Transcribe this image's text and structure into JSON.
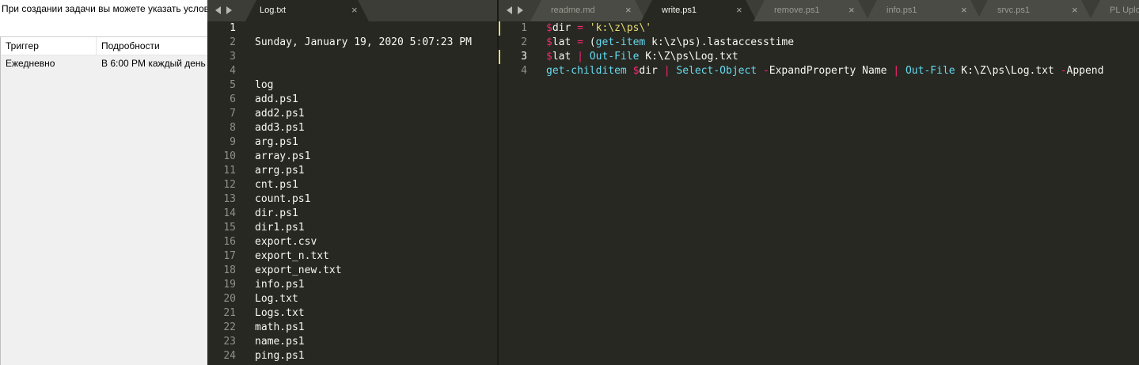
{
  "left_window": {
    "description": "При создании задачи вы можете указать услови",
    "columns": [
      "Триггер",
      "Подробности"
    ],
    "rows": [
      {
        "trigger": "Ежедневно",
        "details": "В 6:00 PM каждый день"
      }
    ]
  },
  "pane1": {
    "tabs": [
      {
        "label": "Log.txt",
        "close": "×",
        "active": true
      }
    ],
    "line_numbers": [
      "1",
      "2",
      "3",
      "4",
      "5",
      "6",
      "7",
      "8",
      "9",
      "10",
      "11",
      "12",
      "13",
      "14",
      "15",
      "16",
      "17",
      "18",
      "19",
      "20",
      "21",
      "22",
      "23",
      "24"
    ],
    "lines": [
      "",
      "Sunday, January 19, 2020 5:07:23 PM",
      "",
      "",
      "log",
      "add.ps1",
      "add2.ps1",
      "add3.ps1",
      "arg.ps1",
      "array.ps1",
      "arrg.ps1",
      "cnt.ps1",
      "count.ps1",
      "dir.ps1",
      "dir1.ps1",
      "export.csv",
      "export_n.txt",
      "export_new.txt",
      "info.ps1",
      "Log.txt",
      "Logs.txt",
      "math.ps1",
      "name.ps1",
      "ping.ps1"
    ]
  },
  "pane2": {
    "tabs": [
      {
        "label": "readme.md",
        "close": "×",
        "active": false
      },
      {
        "label": "write.ps1",
        "close": "×",
        "active": true
      },
      {
        "label": "remove.ps1",
        "close": "×",
        "active": false
      },
      {
        "label": "info.ps1",
        "close": "×",
        "active": false
      },
      {
        "label": "srvc.ps1",
        "close": "×",
        "active": false
      },
      {
        "label": "PL Uplo",
        "close": "",
        "active": false
      }
    ],
    "line_numbers": [
      "1",
      "2",
      "3",
      "4"
    ],
    "code_lines": [
      [
        {
          "t": "$",
          "c": "var"
        },
        {
          "t": "dir ",
          "c": "plain"
        },
        {
          "t": "=",
          "c": "op"
        },
        {
          "t": " ",
          "c": "plain"
        },
        {
          "t": "'k:\\z\\ps\\'",
          "c": "str"
        }
      ],
      [
        {
          "t": "$",
          "c": "var"
        },
        {
          "t": "lat ",
          "c": "plain"
        },
        {
          "t": "=",
          "c": "op"
        },
        {
          "t": " (",
          "c": "plain"
        },
        {
          "t": "get-item",
          "c": "fn"
        },
        {
          "t": " k:\\z\\ps).lastaccesstime",
          "c": "plain"
        }
      ],
      [
        {
          "t": "$",
          "c": "var"
        },
        {
          "t": "lat ",
          "c": "plain"
        },
        {
          "t": "|",
          "c": "op"
        },
        {
          "t": " ",
          "c": "plain"
        },
        {
          "t": "Out-File",
          "c": "fn"
        },
        {
          "t": " K:\\Z\\ps\\Log.txt",
          "c": "plain"
        }
      ],
      [
        {
          "t": "get-childitem",
          "c": "fn"
        },
        {
          "t": " ",
          "c": "plain"
        },
        {
          "t": "$",
          "c": "var"
        },
        {
          "t": "dir ",
          "c": "plain"
        },
        {
          "t": "|",
          "c": "op"
        },
        {
          "t": " ",
          "c": "plain"
        },
        {
          "t": "Select-Object",
          "c": "fn"
        },
        {
          "t": " ",
          "c": "plain"
        },
        {
          "t": "-",
          "c": "op"
        },
        {
          "t": "ExpandProperty Name ",
          "c": "plain"
        },
        {
          "t": "|",
          "c": "op"
        },
        {
          "t": " ",
          "c": "plain"
        },
        {
          "t": "Out-File",
          "c": "fn"
        },
        {
          "t": " K:\\Z\\ps\\Log.txt ",
          "c": "plain"
        },
        {
          "t": "-",
          "c": "op"
        },
        {
          "t": "Append",
          "c": "plain"
        }
      ]
    ],
    "modified_lines": [
      1,
      3
    ]
  },
  "colors": {
    "editor_bg": "#272822",
    "tabbar_bg": "#3c3d37",
    "keyword": "#f92672",
    "string": "#e6db74",
    "function": "#66d9ef",
    "text": "#f8f8f2"
  }
}
